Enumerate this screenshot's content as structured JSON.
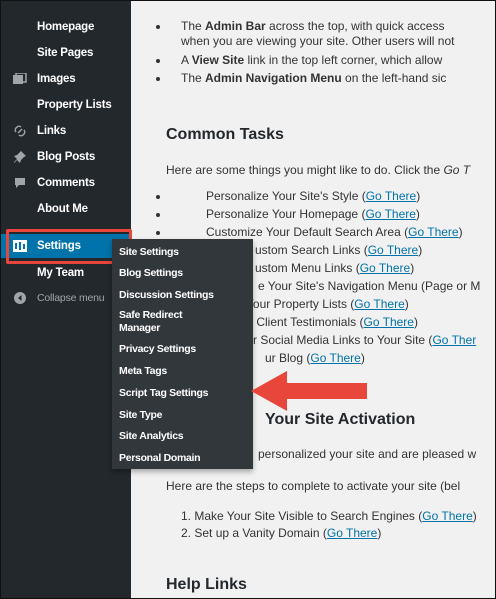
{
  "sidebar": {
    "items": [
      {
        "label": "Homepage",
        "icon": ""
      },
      {
        "label": "Site Pages",
        "icon": ""
      },
      {
        "label": "Images",
        "icon": "images-icon"
      },
      {
        "label": "Property Lists",
        "icon": ""
      },
      {
        "label": "Links",
        "icon": "link-icon"
      },
      {
        "label": "Blog Posts",
        "icon": "pin-icon"
      },
      {
        "label": "Comments",
        "icon": "comment-icon"
      },
      {
        "label": "About Me",
        "icon": ""
      },
      {
        "label": "Settings",
        "icon": "settings-icon"
      },
      {
        "label": "My Team",
        "icon": ""
      },
      {
        "label": "Collapse menu",
        "icon": "collapse-icon"
      }
    ],
    "active_color": "#0073aa",
    "highlight_color": "#e8463b"
  },
  "flyout": {
    "items": [
      "Site Settings",
      "Blog Settings",
      "Discussion Settings",
      "Safe Redirect\nManager",
      "Privacy Settings",
      "Meta Tags",
      "Script Tag Settings",
      "Site Type",
      "Site Analytics",
      "Personal Domain"
    ]
  },
  "content": {
    "intro": [
      {
        "pre": "The ",
        "bold": "Admin Bar",
        "post": " across the top, with quick access"
      },
      {
        "pre": "when you are viewing your site. Other users will not",
        "bold": "",
        "post": ""
      },
      {
        "pre": "A ",
        "bold": "View Site",
        "post": " link in the top left corner, which allow"
      },
      {
        "pre": "The ",
        "bold": "Admin Navigation Menu",
        "post": " on the left-hand sic"
      }
    ],
    "common_tasks_heading": "Common Tasks",
    "common_tasks_desc": "Here are some things you might like to do. Click the ",
    "common_tasks_desc_italic": "Go T",
    "tasks": [
      {
        "text": "Personalize Your Site's Style (",
        "link": "Go There",
        "end": ")"
      },
      {
        "text": "Personalize Your Homepage (",
        "link": "Go There",
        "end": ")"
      },
      {
        "text": "Customize Your Default Search Area (",
        "link": "Go There",
        "end": ")"
      },
      {
        "text": "ustom Search Links (",
        "link": "Go There",
        "end": ")"
      },
      {
        "text": "ustom Menu Links (",
        "link": "Go There",
        "end": ")"
      },
      {
        "text": "e Your Site's Navigation Menu (Page or M",
        "link": "",
        "end": ""
      },
      {
        "text": "Your Property Lists (",
        "link": "Go There",
        "end": ")"
      },
      {
        "text": "r Client Testimonials (",
        "link": "Go There",
        "end": ")"
      },
      {
        "text": "r Social Media Links to Your Site (",
        "link": "Go Ther",
        "end": ""
      },
      {
        "text": "ur Blog (",
        "link": "Go There",
        "end": ")"
      }
    ],
    "activation_heading": "Your Site Activation",
    "activation_line1": "personalized your site and are pleased w",
    "activation_line2": "Here are the steps to complete to activate your site (bel",
    "steps": [
      {
        "text": "1. Make Your Site Visible to Search Engines (",
        "link": "Go There",
        "end": ")"
      },
      {
        "text": "2. Set up a Vanity Domain (",
        "link": "Go There",
        "end": ")"
      }
    ],
    "help_heading": "Help Links"
  },
  "colors": {
    "sidebar_bg": "#23282d",
    "flyout_bg": "#32373c",
    "content_bg": "#f1f1f1",
    "link": "#0073aa",
    "arrow": "#e8463b"
  }
}
